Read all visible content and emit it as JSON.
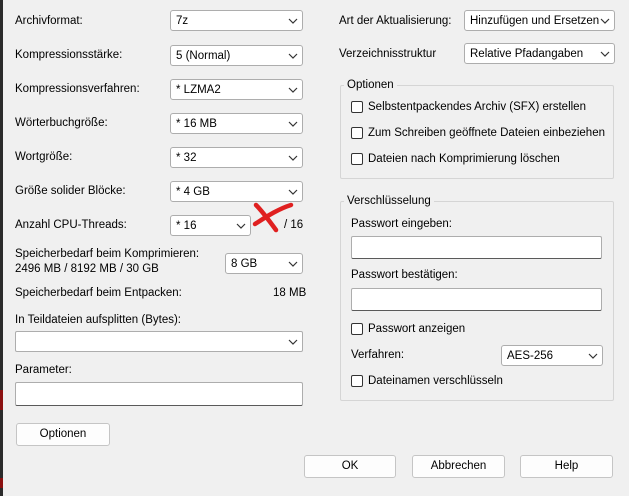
{
  "left": {
    "archive_format": {
      "label": "Archivformat:",
      "value": "7z"
    },
    "compression_level": {
      "label": "Kompressionsstärke:",
      "value": "5 (Normal)"
    },
    "compression_method": {
      "label": "Kompressionsverfahren:",
      "value": "*  LZMA2"
    },
    "dictionary_size": {
      "label": "Wörterbuchgröße:",
      "value": "*  16 MB"
    },
    "word_size": {
      "label": "Wortgröße:",
      "value": "*  32"
    },
    "solid_block_size": {
      "label": "Größe solider Blöcke:",
      "value": "*  4 GB"
    },
    "cpu_threads": {
      "label": "Anzahl CPU-Threads:",
      "value": "*  16",
      "max": "/ 16"
    },
    "memory_compress": {
      "label_line1": "Speicherbedarf beim Komprimieren:",
      "label_line2": "2496 MB / 8192 MB / 30 GB",
      "value": "8 GB"
    },
    "memory_decompress": {
      "label": "Speicherbedarf beim Entpacken:",
      "value": "18 MB"
    },
    "split_volumes": {
      "label": "In Teildateien aufsplitten (Bytes):",
      "value": ""
    },
    "parameters": {
      "label": "Parameter:",
      "value": ""
    },
    "options_button": "Optionen"
  },
  "right": {
    "update_mode": {
      "label": "Art der Aktualisierung:",
      "value": "Hinzufügen und Ersetzen"
    },
    "path_mode": {
      "label": "Verzeichnisstruktur",
      "value": "Relative Pfadangaben"
    },
    "options_group": {
      "title": "Optionen",
      "sfx": "Selbstentpackendes Archiv (SFX) erstellen",
      "shared_files": "Zum Schreiben geöffnete Dateien einbeziehen",
      "delete_after": "Dateien nach Komprimierung löschen"
    },
    "encryption_group": {
      "title": "Verschlüsselung",
      "password_label": "Passwort eingeben:",
      "password_confirm_label": "Passwort bestätigen:",
      "show_password": "Passwort anzeigen",
      "method_label": "Verfahren:",
      "method_value": "AES-256",
      "encrypt_names": "Dateinamen verschlüsseln"
    }
  },
  "buttons": {
    "ok": "OK",
    "cancel": "Abbrechen",
    "help": "Help"
  },
  "colors": {
    "annotation_mark": "#e02020",
    "background": "#f0f0f0"
  },
  "icons": {
    "dropdown": "chevron-down-icon",
    "annotation": "red-x-mark-icon"
  }
}
